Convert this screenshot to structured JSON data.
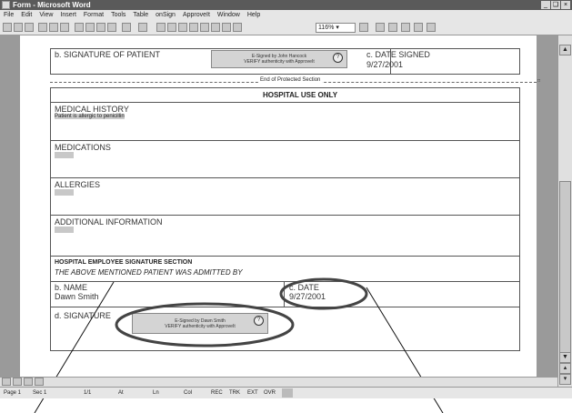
{
  "window": {
    "title": "Form - Microsoft Word",
    "controls": [
      "_",
      "❑",
      "×"
    ]
  },
  "menu": [
    "File",
    "Edit",
    "View",
    "Insert",
    "Format",
    "Tools",
    "Table",
    "onSign",
    "ApproveIt",
    "Window",
    "Help"
  ],
  "toolbar": {
    "zoom": "116%"
  },
  "form": {
    "patient_signature_label": "b. SIGNATURE OF PATIENT",
    "patient_sig": {
      "line1": "E-Signed by John Hancock",
      "line2": "VERIFY authenticity with ApproveIt",
      "qmark": "?"
    },
    "date_signed_label": "c. DATE SIGNED",
    "date_signed_value": "9/27/2001",
    "end_protected": "End of Protected Section",
    "hospital_header": "HOSPITAL USE ONLY",
    "medical_history_label": "MEDICAL HISTORY",
    "medical_history_value": "Patient is allergic to penicillin",
    "medications_label": "MEDICATIONS",
    "allergies_label": "ALLERGIES",
    "additional_label": "ADDITIONAL INFORMATION",
    "employee_section_title": "HOSPITAL EMPLOYEE SIGNATURE SECTION",
    "employee_section_sub": "THE ABOVE MENTIONED PATIENT WAS ADMITTED BY",
    "name_label": "b. NAME",
    "name_value": "Dawn Smith",
    "date_label": "c. DATE",
    "date_value": "9/27/2001",
    "signature_label": "d. SIGNATURE",
    "employee_sig": {
      "line1": "E-Signed by Dawn Smith",
      "line2": "VERIFY authenticity with ApproveIt",
      "qmark": "?"
    }
  },
  "status": {
    "page": "Page 1",
    "sec": "Sec 1",
    "pos": "1/1",
    "at": "At",
    "ln": "Ln",
    "col": "Col",
    "rec": "REC",
    "trk": "TRK",
    "ext": "EXT",
    "ovr": "OVR"
  }
}
